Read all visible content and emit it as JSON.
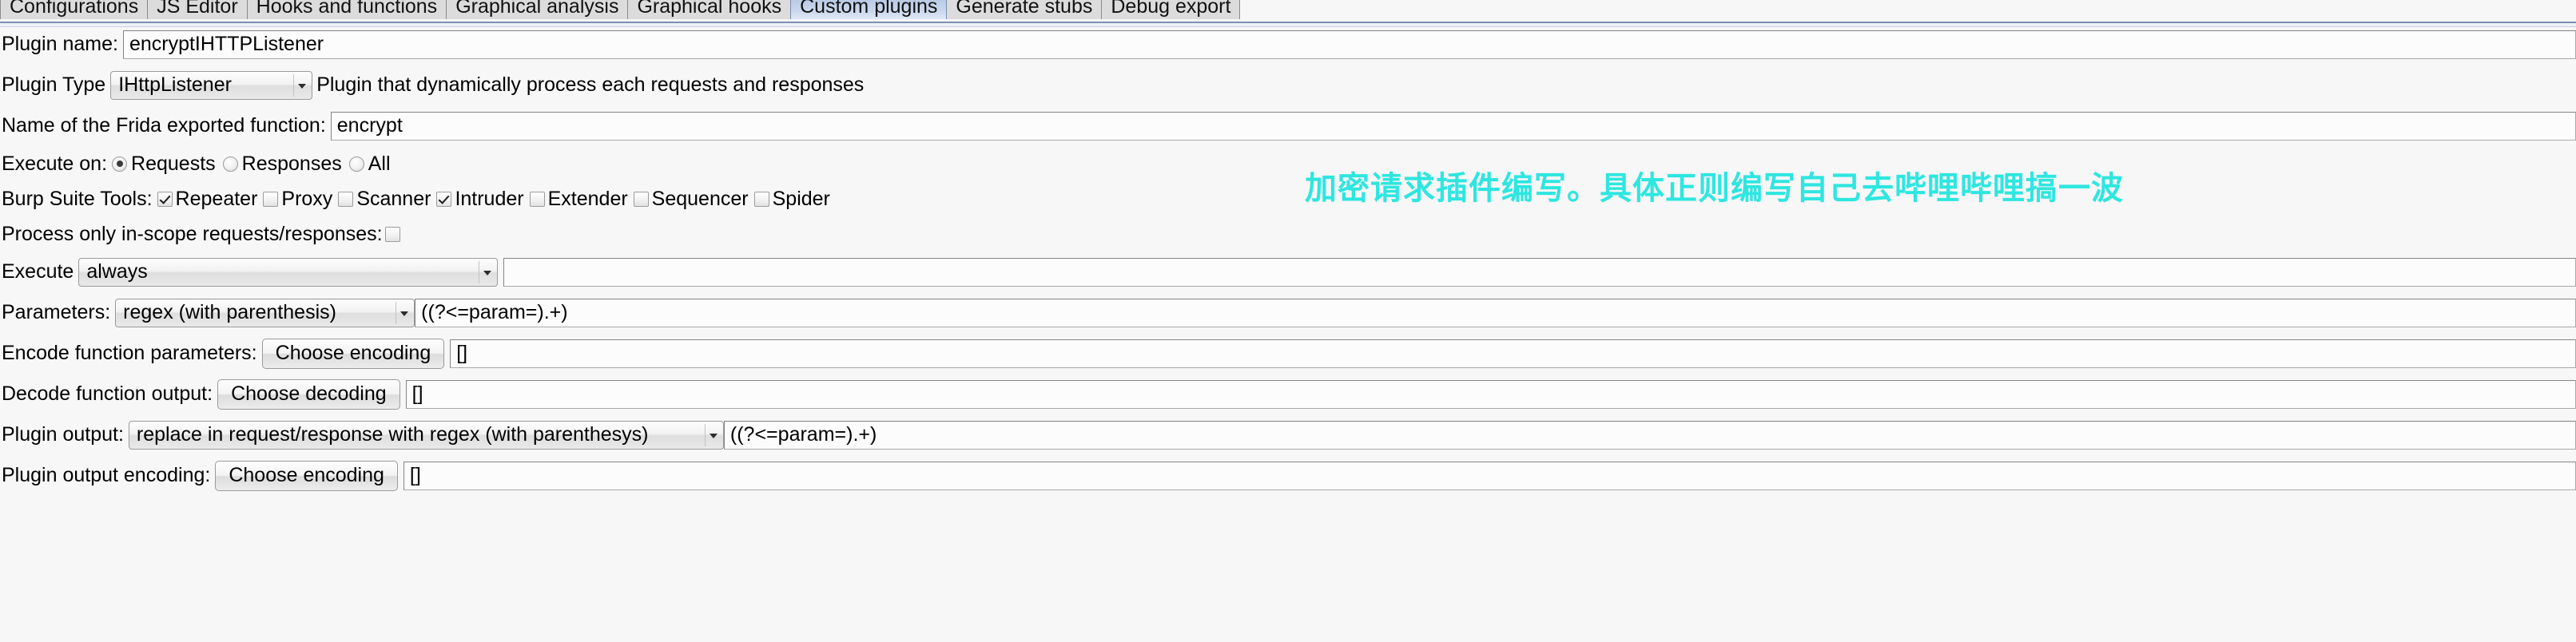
{
  "tabs": [
    {
      "label": "Configurations",
      "selected": false
    },
    {
      "label": "JS Editor",
      "selected": false
    },
    {
      "label": "Hooks and functions",
      "selected": false
    },
    {
      "label": "Graphical analysis",
      "selected": false
    },
    {
      "label": "Graphical hooks",
      "selected": false
    },
    {
      "label": "Custom plugins",
      "selected": true
    },
    {
      "label": "Generate stubs",
      "selected": false
    },
    {
      "label": "Debug export",
      "selected": false
    }
  ],
  "form": {
    "plugin_name": {
      "label": "Plugin name:",
      "value": "encryptIHTTPListener"
    },
    "plugin_type": {
      "label": "Plugin Type",
      "value": "IHttpListener",
      "description": "Plugin that dynamically process each requests and responses"
    },
    "frida_function": {
      "label": "Name of the Frida exported function:",
      "value": "encrypt"
    },
    "execute_on": {
      "label": "Execute on:",
      "options": [
        {
          "label": "Requests",
          "checked": true
        },
        {
          "label": "Responses",
          "checked": false
        },
        {
          "label": "All",
          "checked": false
        }
      ]
    },
    "burp_tools": {
      "label": "Burp Suite Tools:",
      "options": [
        {
          "label": "Repeater",
          "checked": true
        },
        {
          "label": "Proxy",
          "checked": false
        },
        {
          "label": "Scanner",
          "checked": false
        },
        {
          "label": "Intruder",
          "checked": true
        },
        {
          "label": "Extender",
          "checked": false
        },
        {
          "label": "Sequencer",
          "checked": false
        },
        {
          "label": "Spider",
          "checked": false
        }
      ]
    },
    "in_scope": {
      "label": "Process only in-scope requests/responses:",
      "checked": false
    },
    "execute": {
      "label": "Execute",
      "value": "always"
    },
    "parameters": {
      "label": "Parameters:",
      "value": "regex (with parenthesis)",
      "regex": "((?<=param=).+)"
    },
    "encode_parameters": {
      "label": "Encode function parameters:",
      "button": "Choose encoding",
      "value": "[]"
    },
    "decode_output": {
      "label": "Decode function output:",
      "button": "Choose decoding",
      "value": "[]"
    },
    "plugin_output": {
      "label": "Plugin output:",
      "value": "replace in request/response with regex (with parenthesys)",
      "regex": "((?<=param=).+)"
    },
    "plugin_output_encoding": {
      "label": "Plugin output encoding:",
      "button": "Choose encoding",
      "value": "[]"
    }
  },
  "annotation": {
    "text": "加密请求插件编写。具体正则编写自己去哔哩哔哩搞一波",
    "color": "#2ee6e0"
  }
}
